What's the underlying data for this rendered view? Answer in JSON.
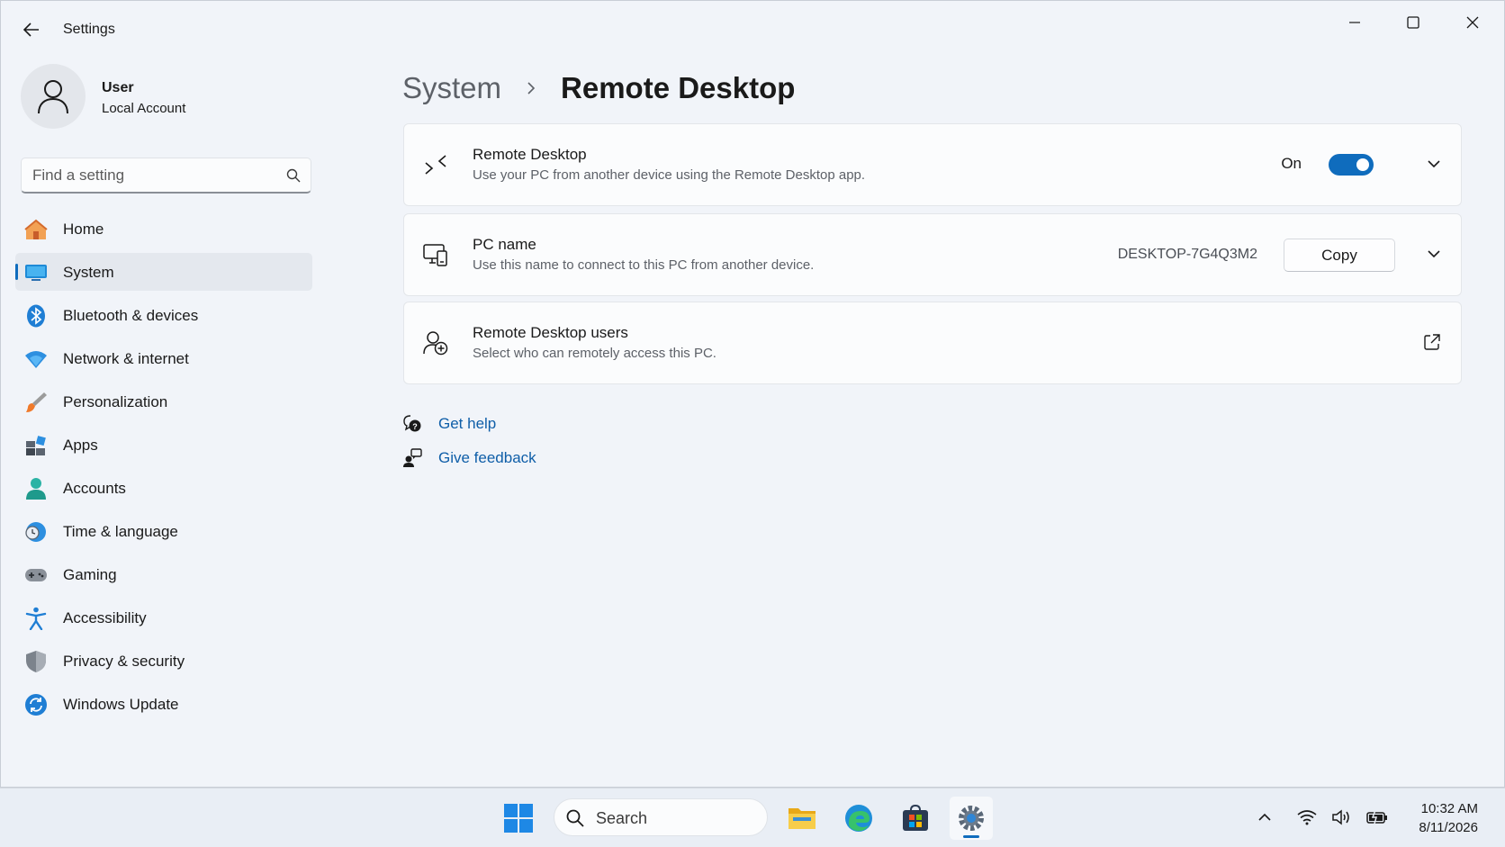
{
  "window": {
    "title": "Settings"
  },
  "profile": {
    "name": "User",
    "account_type": "Local Account"
  },
  "search": {
    "placeholder": "Find a setting"
  },
  "nav": [
    {
      "label": "Home",
      "icon": "home-icon"
    },
    {
      "label": "System",
      "icon": "system-icon",
      "active": true
    },
    {
      "label": "Bluetooth & devices",
      "icon": "bluetooth-icon"
    },
    {
      "label": "Network & internet",
      "icon": "wifi-icon"
    },
    {
      "label": "Personalization",
      "icon": "brush-icon"
    },
    {
      "label": "Apps",
      "icon": "apps-icon"
    },
    {
      "label": "Accounts",
      "icon": "accounts-icon"
    },
    {
      "label": "Time & language",
      "icon": "globe-clock-icon"
    },
    {
      "label": "Gaming",
      "icon": "gamepad-icon"
    },
    {
      "label": "Accessibility",
      "icon": "accessibility-icon"
    },
    {
      "label": "Privacy & security",
      "icon": "shield-icon"
    },
    {
      "label": "Windows Update",
      "icon": "update-icon"
    }
  ],
  "breadcrumb": {
    "parent": "System",
    "current": "Remote Desktop"
  },
  "cards": {
    "remote_desktop": {
      "title": "Remote Desktop",
      "description": "Use your PC from another device using the Remote Desktop app.",
      "toggle_label": "On",
      "toggle_on": true
    },
    "pc_name": {
      "title": "PC name",
      "description": "Use this name to connect to this PC from another device.",
      "value": "DESKTOP-7G4Q3M2",
      "copy_label": "Copy"
    },
    "rd_users": {
      "title": "Remote Desktop users",
      "description": "Select who can remotely access this PC."
    }
  },
  "links": {
    "get_help": "Get help",
    "give_feedback": "Give feedback"
  },
  "taskbar": {
    "search_label": "Search",
    "time": "10:32 AM",
    "date": "8/11/2026"
  },
  "colors": {
    "accent": "#0f6cbd",
    "link": "#0f5ea8",
    "window_bg": "#f1f4f9",
    "card_bg": "#fbfcfd"
  }
}
